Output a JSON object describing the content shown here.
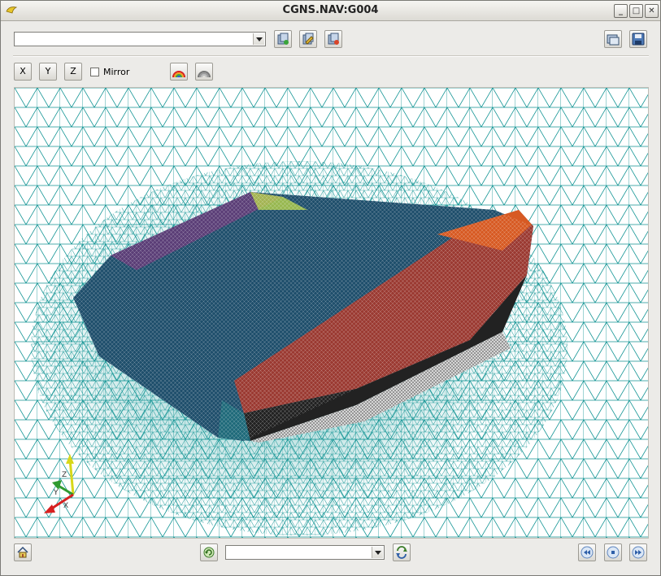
{
  "window": {
    "title": "CGNS.NAV:G004"
  },
  "toolbar": {
    "path_combo_value": "",
    "mirror_label": "Mirror",
    "mirror_checked": false,
    "axis_buttons": [
      "X",
      "Y",
      "Z"
    ]
  },
  "viewport": {
    "mesh_color": "#129494",
    "axes_labels": [
      "Z",
      "Y",
      "X"
    ]
  },
  "bottom": {
    "selection_combo_value": ""
  }
}
